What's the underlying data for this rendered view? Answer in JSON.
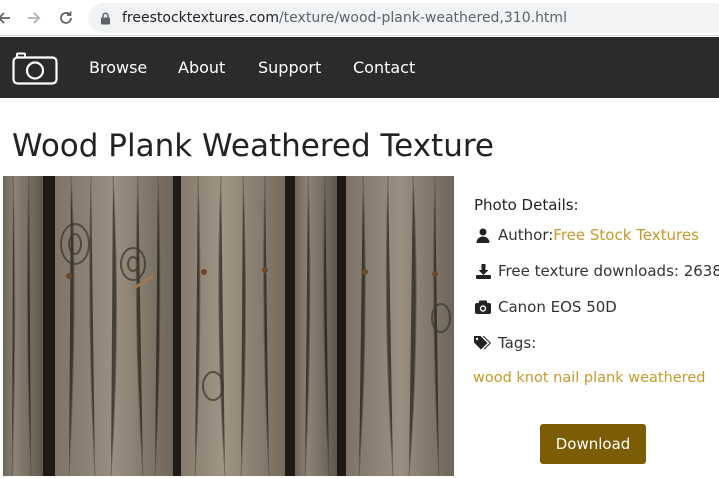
{
  "browser": {
    "url_domain": "freestocktextures.com",
    "url_path": "/texture/wood-plank-weathered,310.html"
  },
  "nav": {
    "items": [
      {
        "label": "Browse"
      },
      {
        "label": "About"
      },
      {
        "label": "Support"
      },
      {
        "label": "Contact"
      }
    ]
  },
  "page": {
    "title": "Wood Plank Weathered Texture"
  },
  "details": {
    "heading": "Photo Details:",
    "author_label": "Author: ",
    "author_link": "Free Stock Textures",
    "downloads_text": "Free texture downloads: 2638",
    "camera": "Canon EOS 50D",
    "tags_label": "Tags:",
    "tags": "wood knot nail plank weathered",
    "download_label": "Download"
  },
  "colors": {
    "nav_bg": "#2b2b2b",
    "link": "#c49a2a",
    "button": "#7c5c05"
  },
  "icons": {
    "back": "arrow-left-icon",
    "forward": "arrow-right-icon",
    "reload": "reload-icon",
    "lock": "lock-icon",
    "logo": "camera-icon",
    "author": "user-icon",
    "downloads": "download-icon",
    "camera": "camera-icon",
    "tags": "tags-icon"
  }
}
